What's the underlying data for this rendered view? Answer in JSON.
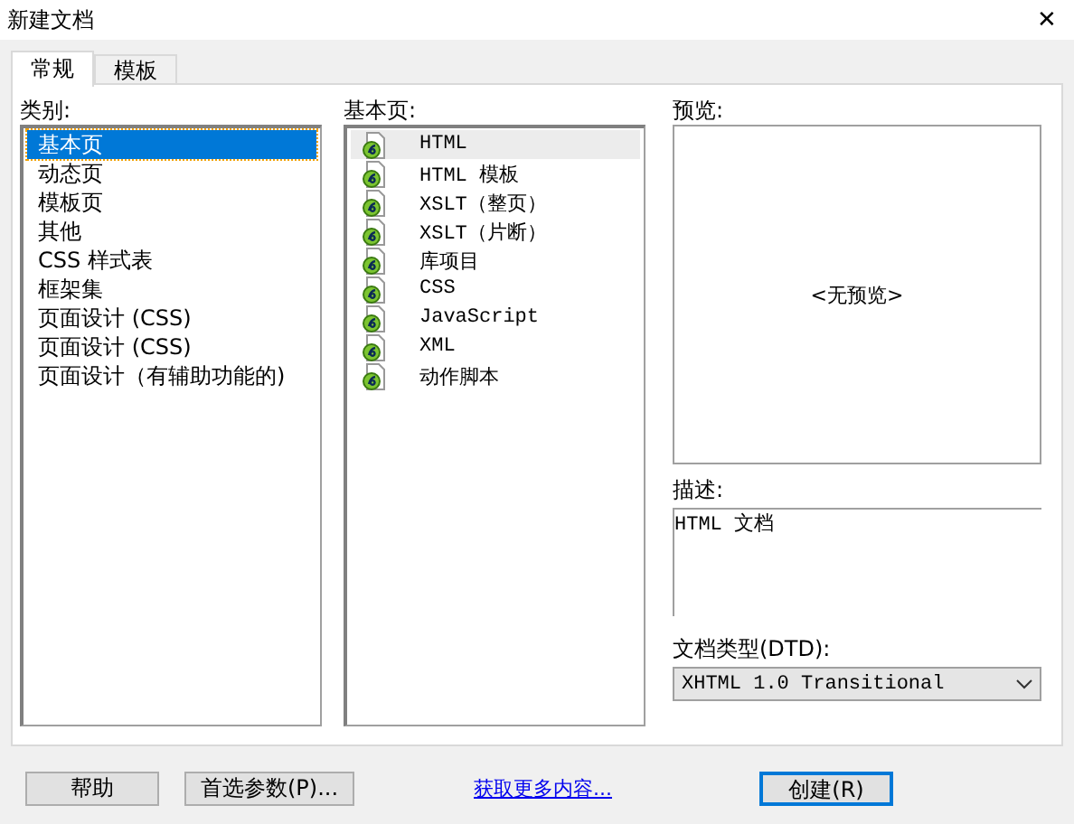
{
  "window": {
    "title": "新建文档",
    "close": "✕"
  },
  "tabs": [
    {
      "label": "常规",
      "selected": true
    },
    {
      "label": "模板",
      "selected": false
    }
  ],
  "category": {
    "label": "类别:",
    "items": [
      {
        "label": "基本页",
        "selected": true
      },
      {
        "label": "动态页",
        "selected": false
      },
      {
        "label": "模板页",
        "selected": false
      },
      {
        "label": "其他",
        "selected": false
      },
      {
        "label": "CSS 样式表",
        "selected": false
      },
      {
        "label": "框架集",
        "selected": false
      },
      {
        "label": "页面设计 (CSS)",
        "selected": false
      },
      {
        "label": "页面设计 (CSS)",
        "selected": false
      },
      {
        "label": "页面设计（有辅助功能的)",
        "selected": false
      }
    ]
  },
  "pages": {
    "label": "基本页:",
    "items": [
      {
        "label": "HTML",
        "selected": true
      },
      {
        "label": "HTML 模板",
        "selected": false
      },
      {
        "label": "XSLT（整页）",
        "selected": false
      },
      {
        "label": "XSLT（片断）",
        "selected": false
      },
      {
        "label": "库项目",
        "selected": false
      },
      {
        "label": "CSS",
        "selected": false
      },
      {
        "label": "JavaScript",
        "selected": false
      },
      {
        "label": "XML",
        "selected": false
      },
      {
        "label": "动作脚本",
        "selected": false
      }
    ]
  },
  "preview": {
    "label": "预览:",
    "text": "<无预览>"
  },
  "description": {
    "label": "描述:",
    "text": "HTML 文档"
  },
  "doctype": {
    "label": "文档类型(DTD):",
    "value": "XHTML 1.0 Transitional"
  },
  "buttons": [
    {
      "label": "帮助",
      "kind": "button"
    },
    {
      "label": "首选参数(P)...",
      "kind": "button"
    },
    {
      "label": "获取更多内容...",
      "kind": "link"
    },
    {
      "label": "创建(R)",
      "kind": "default"
    }
  ]
}
